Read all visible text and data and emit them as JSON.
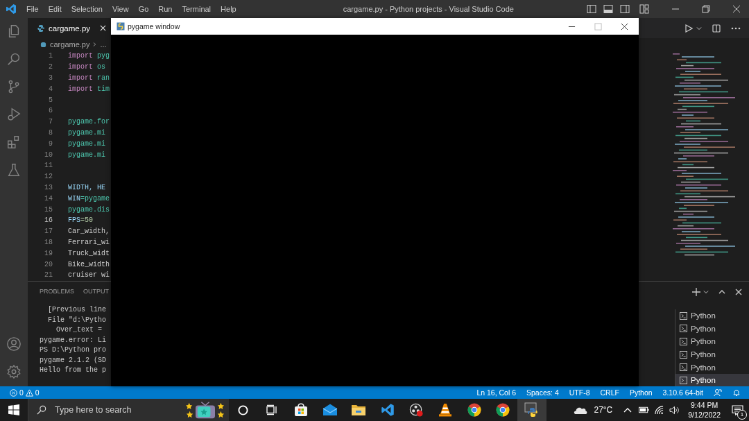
{
  "title_bar": {
    "menu": [
      "File",
      "Edit",
      "Selection",
      "View",
      "Go",
      "Run",
      "Terminal",
      "Help"
    ],
    "title": "cargame.py - Python projects - Visual Studio Code"
  },
  "editor": {
    "tab": {
      "label": "cargame.py",
      "selected": true
    },
    "breadcrumb": {
      "file": "cargame.py",
      "rest": "..."
    },
    "lines": [
      {
        "number": "1",
        "current": false,
        "segments": [
          {
            "text": "import",
            "kind": "keyword"
          },
          {
            "text": " pyg",
            "kind": "module"
          }
        ]
      },
      {
        "number": "2",
        "current": false,
        "segments": [
          {
            "text": "import",
            "kind": "keyword"
          },
          {
            "text": " os",
            "kind": "module"
          }
        ]
      },
      {
        "number": "3",
        "current": false,
        "segments": [
          {
            "text": "import",
            "kind": "keyword"
          },
          {
            "text": " ran",
            "kind": "module"
          }
        ]
      },
      {
        "number": "4",
        "current": false,
        "segments": [
          {
            "text": "import",
            "kind": "keyword"
          },
          {
            "text": " tim",
            "kind": "module"
          }
        ]
      },
      {
        "number": "5",
        "current": false
      },
      {
        "number": "6",
        "current": false
      },
      {
        "number": "7",
        "current": false,
        "segments": [
          {
            "text": "pygame.for",
            "kind": "module"
          }
        ]
      },
      {
        "number": "8",
        "current": false,
        "segments": [
          {
            "text": "pygame.mi",
            "kind": "module"
          }
        ]
      },
      {
        "number": "9",
        "current": false,
        "segments": [
          {
            "text": "pygame.mi",
            "kind": "module"
          }
        ]
      },
      {
        "number": "10",
        "current": false,
        "segments": [
          {
            "text": "pygame.mi",
            "kind": "module"
          }
        ]
      },
      {
        "number": "11",
        "current": false
      },
      {
        "number": "12",
        "current": false
      },
      {
        "number": "13",
        "current": false,
        "segments": [
          {
            "text": "WIDTH, HE",
            "kind": "variable"
          }
        ]
      },
      {
        "number": "14",
        "current": false,
        "segments": [
          {
            "text": "WIN",
            "kind": "variable"
          },
          {
            "text": "=pygame",
            "kind": "module"
          }
        ]
      },
      {
        "number": "15",
        "current": false,
        "segments": [
          {
            "text": "pygame.dis",
            "kind": "module"
          }
        ]
      },
      {
        "number": "16",
        "current": true,
        "segments": [
          {
            "text": "FPS",
            "kind": "variable"
          },
          {
            "text": "=50",
            "kind": "number"
          }
        ]
      },
      {
        "number": "17",
        "current": false,
        "segments": [
          {
            "text": "Car_width,",
            "kind": "plain"
          }
        ]
      },
      {
        "number": "18",
        "current": false,
        "segments": [
          {
            "text": "Ferrari_wi",
            "kind": "plain"
          }
        ]
      },
      {
        "number": "19",
        "current": false,
        "segments": [
          {
            "text": "Truck_widt",
            "kind": "plain"
          }
        ]
      },
      {
        "number": "20",
        "current": false,
        "segments": [
          {
            "text": "Bike_width",
            "kind": "plain"
          }
        ]
      },
      {
        "number": "21",
        "current": false,
        "segments": [
          {
            "text": "cruiser wi",
            "kind": "plain"
          }
        ]
      }
    ]
  },
  "panel": {
    "tabs": [
      {
        "label": "PROBLEMS",
        "selected": false
      },
      {
        "label": "OUTPUT",
        "selected": false
      }
    ],
    "terminal_lines": [
      "  [Previous line",
      "  File \"d:\\Pytho",
      "    Over_text = ",
      "pygame.error: Li",
      "PS D:\\Python pro",
      "pygame 2.1.2 (SD",
      "Hello from the p"
    ],
    "sessions": [
      {
        "label": "Python",
        "selected": false
      },
      {
        "label": "Python",
        "selected": false
      },
      {
        "label": "Python",
        "selected": false
      },
      {
        "label": "Python",
        "selected": false
      },
      {
        "label": "Python",
        "selected": false
      },
      {
        "label": "Python",
        "selected": true
      }
    ]
  },
  "pygame_window": {
    "title": "pygame window"
  },
  "status_bar": {
    "errors": "0",
    "warnings": "0",
    "items": [
      "Ln 16, Col 6",
      "Spaces: 4",
      "UTF-8",
      "CRLF",
      "Python",
      "3.10.6 64-bit"
    ]
  },
  "taskbar": {
    "search": {
      "placeholder": "Type here to search"
    },
    "apps": [
      {
        "kind": "cortana",
        "selected": false
      },
      {
        "kind": "taskview",
        "selected": false
      },
      {
        "kind": "store",
        "selected": false
      },
      {
        "kind": "mail",
        "selected": false
      },
      {
        "kind": "folder",
        "selected": false
      },
      {
        "kind": "vscode",
        "selected": false
      },
      {
        "kind": "recorder",
        "selected": false
      },
      {
        "kind": "cone",
        "selected": false
      },
      {
        "kind": "chrome",
        "selected": false
      },
      {
        "kind": "chrome",
        "selected": false
      },
      {
        "kind": "python",
        "selected": true
      }
    ],
    "temperature": "27°C",
    "time": "9:44 PM",
    "date": "9/12/2022",
    "notifications": "1"
  }
}
